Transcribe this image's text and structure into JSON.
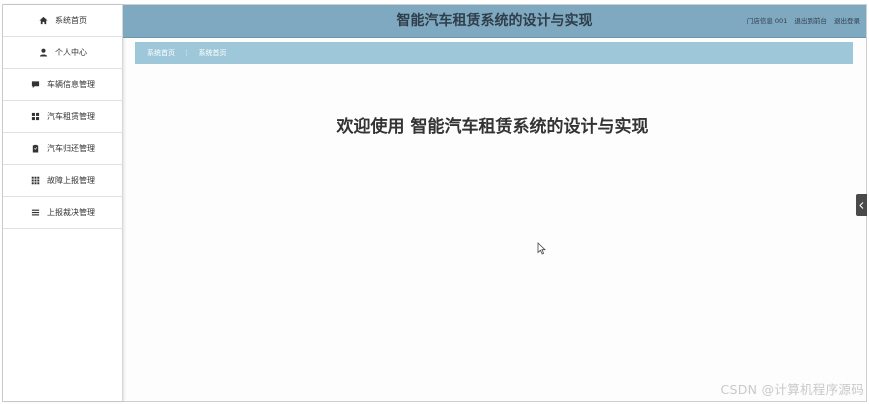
{
  "sidebar": {
    "items": [
      {
        "label": "系统首页",
        "icon": "home-icon"
      },
      {
        "label": "个人中心",
        "icon": "user-icon"
      },
      {
        "label": "车辆信息管理",
        "icon": "comment-icon"
      },
      {
        "label": "汽车租赁管理",
        "icon": "grid-icon"
      },
      {
        "label": "汽车归还管理",
        "icon": "clipboard-icon"
      },
      {
        "label": "故障上报管理",
        "icon": "apps-icon"
      },
      {
        "label": "上报裁决管理",
        "icon": "list-icon"
      }
    ]
  },
  "header": {
    "title": "智能汽车租赁系统的设计与实现",
    "user_info": "门店信息 001",
    "to_frontend": "退出到前台",
    "logout": "退出登录"
  },
  "breadcrumb": {
    "root": "系统首页",
    "separator": "⋮",
    "current": "系统首页"
  },
  "main": {
    "welcome": "欢迎使用 智能汽车租赁系统的设计与实现"
  },
  "watermark": "CSDN @计算机程序源码",
  "colors": {
    "header_bg": "#7fa9c1",
    "breadcrumb_bg": "#9ec8d9",
    "toggle_bg": "#4a4a4a"
  }
}
